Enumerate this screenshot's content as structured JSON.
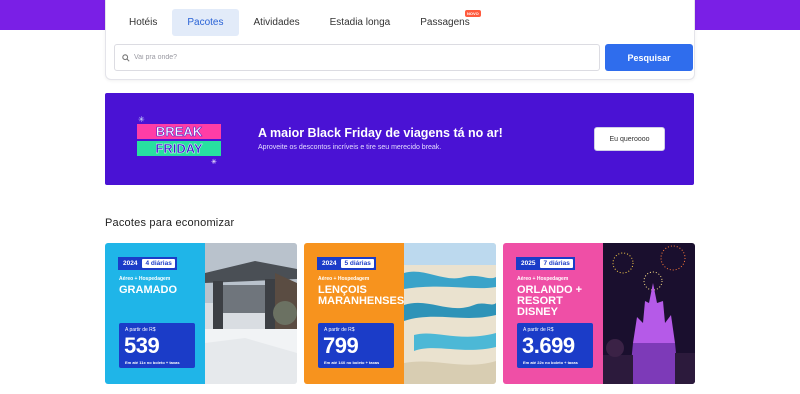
{
  "tabs": [
    {
      "label": "Hotéis",
      "active": false
    },
    {
      "label": "Pacotes",
      "active": true
    },
    {
      "label": "Atividades",
      "active": false
    },
    {
      "label": "Estadia longa",
      "active": false
    },
    {
      "label": "Passagens",
      "active": false,
      "badge": "Novo"
    }
  ],
  "search": {
    "placeholder": "Vai pra onde?",
    "button_label": "Pesquisar"
  },
  "banner": {
    "logo_line1": "BREAK",
    "logo_line2": "FRIDAY",
    "title": "A maior Black Friday de viagens tá no ar!",
    "subtitle": "Aproveite os descontos incríveis e tire seu merecido break.",
    "button_label": "Eu queroooo"
  },
  "section_title": "Pacotes para economizar",
  "packages": [
    {
      "year": "2024",
      "days": "4 diárias",
      "type": "Aéreo + Hospedagem",
      "destination": "GRAMADO",
      "from": "A partir de R$",
      "price": "539",
      "terms": "Em até 11x no boleto + taxas",
      "color": "#1fb5e8"
    },
    {
      "year": "2024",
      "days": "5 diárias",
      "type": "Aéreo + Hospedagem",
      "destination": "LENÇOIS MARANHENSES",
      "from": "A partir de R$",
      "price": "799",
      "terms": "Em até 14X no boleto + taxas",
      "color": "#f7931e"
    },
    {
      "year": "2025",
      "days": "7 diárias",
      "type": "Aéreo + Hospedagem",
      "destination": "ORLANDO + RESORT DISNEY",
      "from": "A partir de R$",
      "price": "3.699",
      "terms": "Em até 22x no boleto + taxas",
      "color": "#ef4fa6"
    }
  ],
  "colors": {
    "brand_purple": "#7a1fe6",
    "banner_bg": "#4a12d4",
    "search_button": "#2f6ded",
    "active_tab_bg": "#e2ebf9",
    "price_box": "#1b3cc8"
  }
}
